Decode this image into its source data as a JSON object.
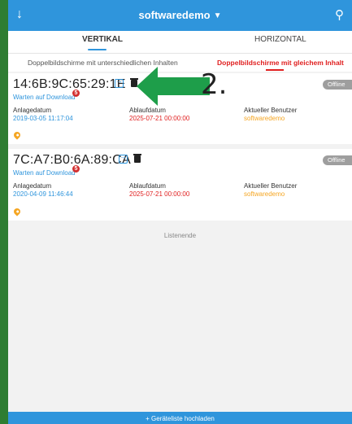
{
  "header": {
    "back_icon": "arrow-down-icon",
    "title": "softwaredemo",
    "search_icon": "search-icon"
  },
  "tabs": [
    {
      "label": "VERTIKAL",
      "active": true
    },
    {
      "label": "HORIZONTAL",
      "active": false
    }
  ],
  "subtabs": [
    {
      "label": "Doppelbildschirme mit unterschiedlichen Inhalten",
      "active": false
    },
    {
      "label": "Doppelbildschirme mit gleichem Inhalt",
      "active": true
    }
  ],
  "devices": [
    {
      "mac": "14:6B:9C:65:29:1E",
      "status": "Warten auf Download",
      "badge": "5",
      "online_state": "Offline",
      "created_label": "Anlagedatum",
      "created_value": "2019-03-05 11:17:04",
      "expiry_label": "Ablaufdatum",
      "expiry_value": "2025-07-21 00:00:00",
      "user_label": "Aktueller Benutzer",
      "user_value": "softwaredemo"
    },
    {
      "mac": "7C:A7:B0:6A:89:CA",
      "status": "Warten auf Download",
      "badge": "5",
      "online_state": "Offline",
      "created_label": "Anlagedatum",
      "created_value": "2020-04-09 11:46:44",
      "expiry_label": "Ablaufdatum",
      "expiry_value": "2025-07-21 00:00:00",
      "user_label": "Aktueller Benutzer",
      "user_value": "softwaredemo"
    }
  ],
  "list_end": "Listenende",
  "bottom_button": "+ Geräteliste hochladen",
  "annotation": {
    "step": "2."
  },
  "colors": {
    "primary": "#2f95dc",
    "accent_red": "#e02020",
    "accent_orange": "#f5a623",
    "arrow_green": "#1e9e4a"
  }
}
